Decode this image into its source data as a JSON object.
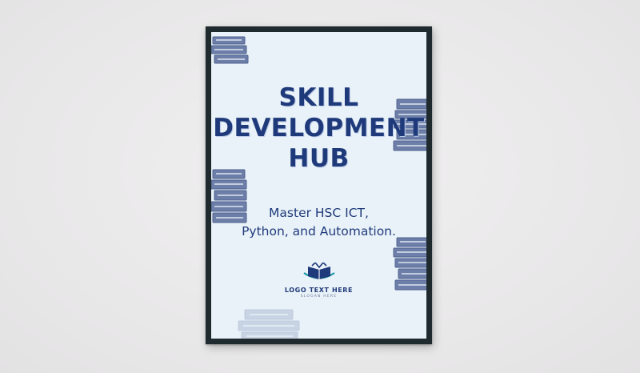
{
  "poster": {
    "title_lines": [
      "SKILL",
      "DEVELOPMENT",
      "HUB"
    ],
    "subtitle_lines": [
      "Master HSC ICT,",
      "Python, and Automation."
    ]
  },
  "logo": {
    "text": "LOGO TEXT HERE",
    "slogan": "SLOGAN HERE",
    "icon": "book-shield-icon"
  },
  "colors": {
    "accent": "#1f3a7a",
    "poster_bg": "#e9f2f8",
    "frame": "#1e2a2e",
    "books": "#6d7fa8",
    "wall": "#ecebec"
  }
}
